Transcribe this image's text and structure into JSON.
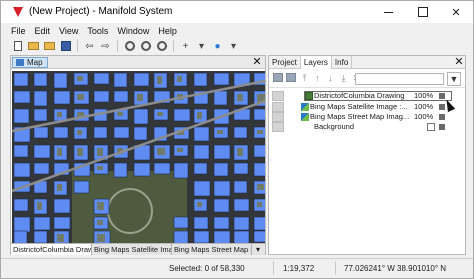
{
  "window": {
    "title": "(New Project) - Manifold System",
    "minimize_label": "",
    "maximize_label": "",
    "close_label": "✕"
  },
  "menu": [
    "File",
    "Edit",
    "View",
    "Tools",
    "Window",
    "Help"
  ],
  "map_pane": {
    "tab_label": "Map",
    "close_label": "✕",
    "layer_tabs": [
      "DistrictofColumbia Drawing",
      "Bing Maps Satellite Imag...",
      "Bing Maps Street Map Im..."
    ],
    "layer_tabs_dropdown": "▾"
  },
  "side_pane": {
    "tabs": [
      "Project",
      "Layers",
      "Info"
    ],
    "active_tab": "Layers",
    "close_label": "✕",
    "filter_placeholder": "",
    "filter_icon": "filter-icon",
    "layers": [
      {
        "name": "DistrictofColumbia Drawing",
        "opacity": "100%",
        "icon": "drawing",
        "selected": true
      },
      {
        "name": "Bing Maps Satellite Image :...",
        "opacity": "100%",
        "icon": "image",
        "selected": false
      },
      {
        "name": "Bing Maps Street Map Imag...",
        "opacity": "100%",
        "icon": "image",
        "selected": false
      },
      {
        "name": "Background",
        "opacity": "",
        "icon": "none",
        "selected": false
      }
    ]
  },
  "status": {
    "selection": "Selected: 0 of 58,330",
    "scale": "1:19,372",
    "coordinates": "77.026241° W 38.901010° N"
  },
  "colors": {
    "building_fill": "#5e8cf2",
    "map_background": "#34373a",
    "selected_tab": "#cfe3f6",
    "logo": "#d9202a"
  }
}
